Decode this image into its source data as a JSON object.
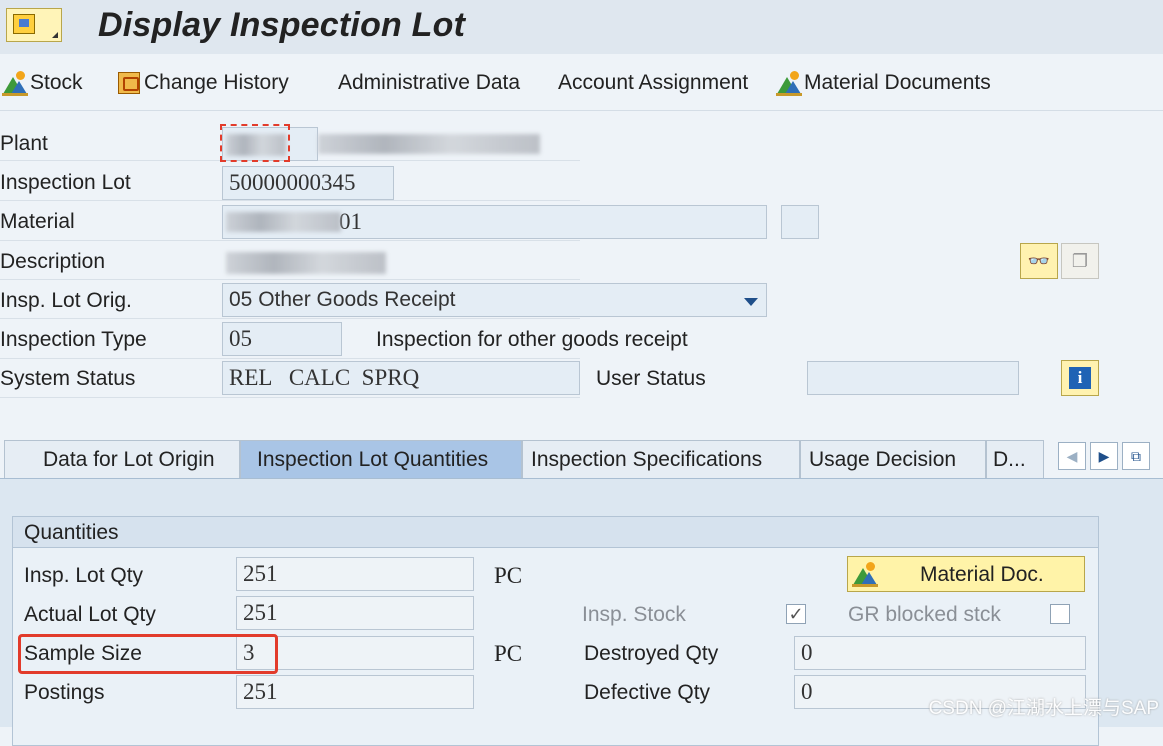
{
  "window": {
    "title": "Display Inspection Lot"
  },
  "toolbar": {
    "items": [
      {
        "label": "Stock",
        "icon": "material-mountain-icon"
      },
      {
        "label": "Change History",
        "icon": "change-history-icon"
      },
      {
        "label": "Administrative Data",
        "icon": ""
      },
      {
        "label": "Account Assignment",
        "icon": ""
      },
      {
        "label": "Material Documents",
        "icon": "material-mountain-icon"
      }
    ]
  },
  "header": {
    "plant": {
      "label": "Plant"
    },
    "inspection_lot": {
      "label": "Inspection Lot",
      "value": "50000000345"
    },
    "material": {
      "label": "Material",
      "value": "01"
    },
    "description": {
      "label": "Description"
    },
    "lot_origin": {
      "label": "Insp. Lot Orig.",
      "value": "05 Other Goods Receipt"
    },
    "inspection_type": {
      "label": "Inspection Type",
      "value": "05",
      "text": "Inspection for other goods receipt"
    },
    "system_status": {
      "label": "System Status",
      "value": "REL   CALC  SPRQ"
    },
    "user_status": {
      "label": "User Status",
      "value": ""
    }
  },
  "tabs": [
    {
      "label": "Data for Lot Origin",
      "active": false
    },
    {
      "label": "Inspection Lot Quantities",
      "active": true
    },
    {
      "label": "Inspection Specifications",
      "active": false
    },
    {
      "label": "Usage Decision",
      "active": false
    },
    {
      "label": "D...",
      "active": false
    }
  ],
  "quantities": {
    "group_title": "Quantities",
    "insp_lot_qty": {
      "label": "Insp. Lot Qty",
      "value": "251",
      "unit": "PC"
    },
    "actual_lot_qty": {
      "label": "Actual Lot Qty",
      "value": "251"
    },
    "sample_size": {
      "label": "Sample Size",
      "value": "3",
      "unit": "PC"
    },
    "postings": {
      "label": "Postings",
      "value": "251"
    },
    "material_doc_button": "Material Doc.",
    "insp_stock": {
      "label": "Insp. Stock",
      "checked": true
    },
    "gr_blocked": {
      "label": "GR blocked stck",
      "checked": false
    },
    "destroyed_qty": {
      "label": "Destroyed Qty",
      "value": "0"
    },
    "defective_qty": {
      "label": "Defective Qty",
      "value": "0"
    }
  },
  "watermark": "CSDN @江湖水上漂与SAP",
  "colors": {
    "highlight": "#e23b2b",
    "active_tab": "#a9c5e6",
    "button_yellow": "#fff3a8"
  }
}
